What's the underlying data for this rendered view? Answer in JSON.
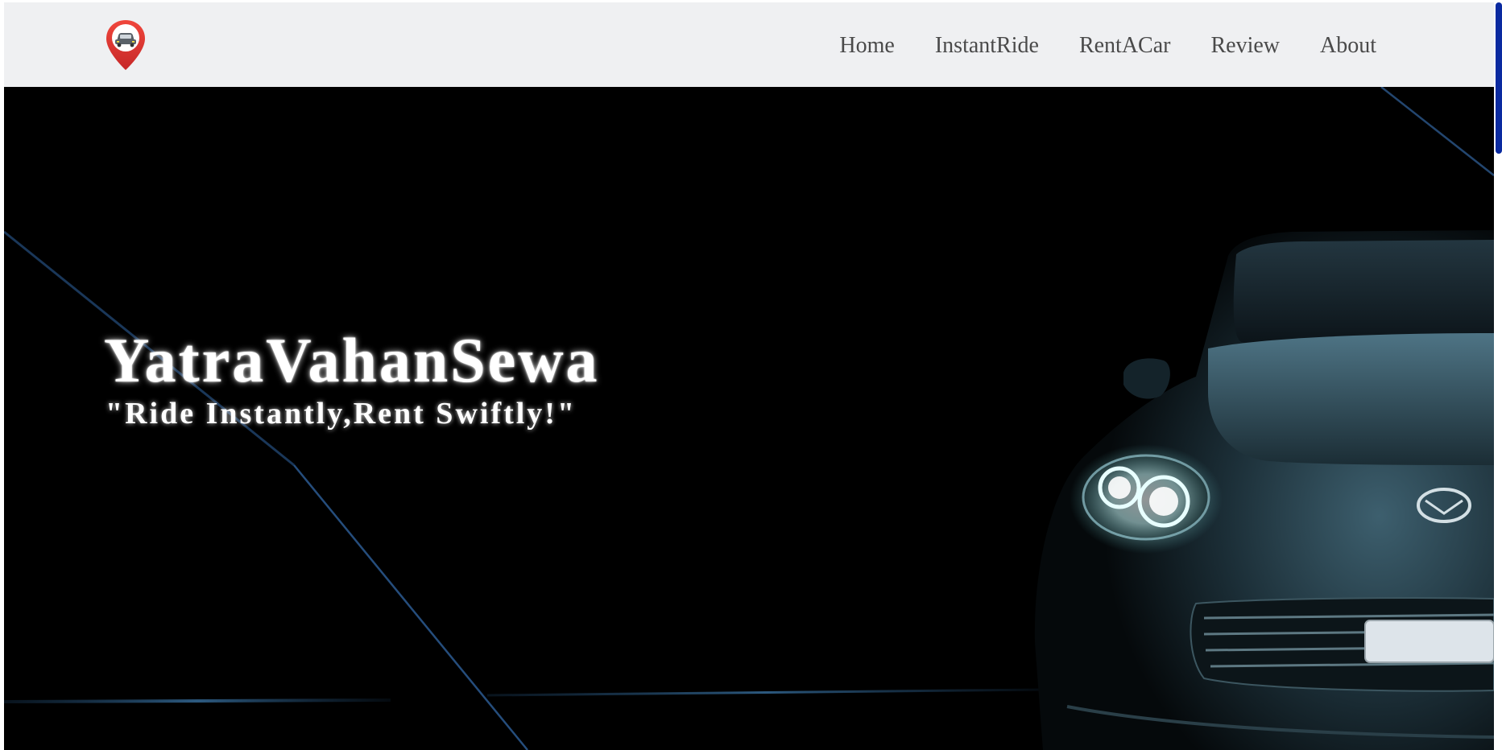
{
  "navbar": {
    "logo_icon": "car-location-pin-icon",
    "links": [
      {
        "label": "Home"
      },
      {
        "label": "InstantRide"
      },
      {
        "label": "RentACar"
      },
      {
        "label": "Review"
      },
      {
        "label": "About"
      }
    ]
  },
  "hero": {
    "title": "YatraVahanSewa",
    "tagline": "\"Ride Instantly,Rent Swiftly!\"",
    "image": "dark-sports-car-headlights"
  },
  "colors": {
    "navbar_bg": "#eff0f2",
    "hero_bg": "#000000",
    "logo_red": "#e53935",
    "scroll_thumb": "#0a2aa0"
  }
}
